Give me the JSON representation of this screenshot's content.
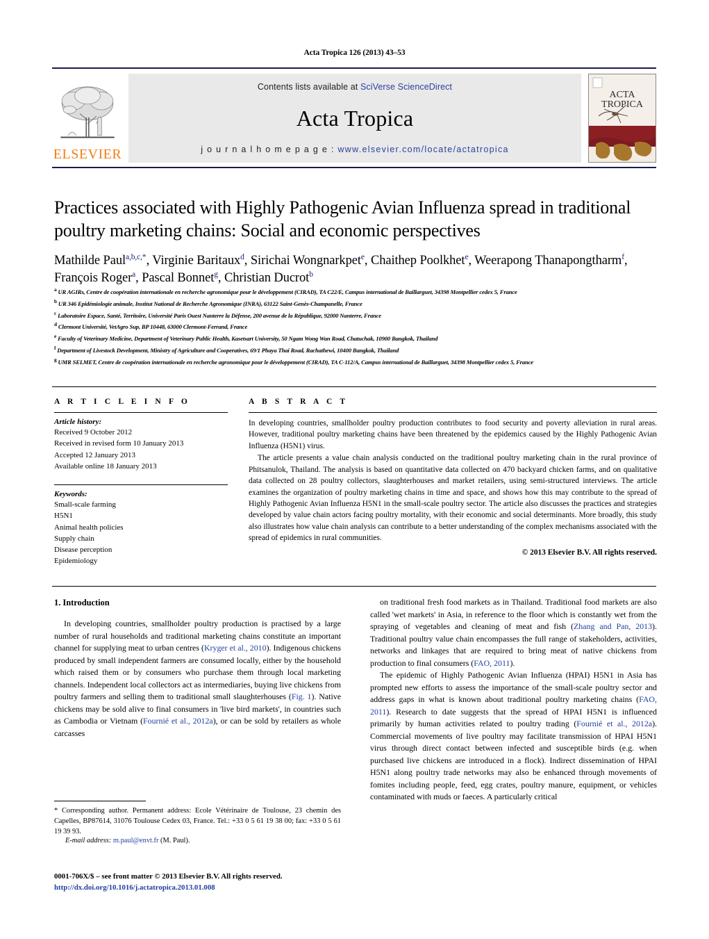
{
  "running_head": "Acta Tropica 126 (2013) 43–53",
  "masthead": {
    "contents_prefix": "Contents lists available at ",
    "contents_link": "SciVerse ScienceDirect",
    "journal_name": "Acta Tropica",
    "homepage_prefix": "j o u r n a l   h o m e p a g e :  ",
    "homepage_url": "www.elsevier.com/locate/actatropica",
    "publisher_wordmark": "ELSEVIER",
    "cover_line1": "ACTA",
    "cover_line2": "TROPICA",
    "accent_color": "#2b3f9e",
    "rule_color": "#1a1a4e",
    "elsevier_orange": "#f07e13"
  },
  "article": {
    "title": "Practices associated with Highly Pathogenic Avian Influenza spread in traditional poultry marketing chains: Social and economic perspectives",
    "authors_line_1": "Mathilde Paul",
    "authors": [
      {
        "name": "Mathilde Paul",
        "sup": "a,b,c,*"
      },
      {
        "name": "Virginie Baritaux",
        "sup": "d"
      },
      {
        "name": "Sirichai Wongnarkpet",
        "sup": "e"
      },
      {
        "name": "Chaithep Poolkhet",
        "sup": "e"
      },
      {
        "name": "Weerapong Thanapongtharm",
        "sup": "f"
      },
      {
        "name": "François Roger",
        "sup": "a"
      },
      {
        "name": "Pascal Bonnet",
        "sup": "g"
      },
      {
        "name": "Christian Ducrot",
        "sup": "b"
      }
    ],
    "affiliations": [
      {
        "mark": "a",
        "text": "UR AGIRs, Centre de coopération internationale en recherche agronomique pour le développement (CIRAD), TA C22/E, Campus international de Baillarguet, 34398 Montpellier cedex 5, France"
      },
      {
        "mark": "b",
        "text": "UR 346 Epidémiologie animale, Institut National de Recherche Agronomique (INRA), 63122 Saint-Genès-Champanelle, France"
      },
      {
        "mark": "c",
        "text": "Laboratoire Espace, Santé, Territoire, Université Paris Ouest Nanterre la Défense, 200 avenue de la République, 92000 Nanterre, France"
      },
      {
        "mark": "d",
        "text": "Clermont Université, VetAgro Sup, BP 10448, 63000 Clermont-Ferrand, France"
      },
      {
        "mark": "e",
        "text": "Faculty of Veterinary Medicine, Department of Veterinary Public Health, Kasetsart University, 50 Ngam Wong Wan Road, Chatuchak, 10900 Bangkok, Thailand"
      },
      {
        "mark": "f",
        "text": "Department of Livestock Development, Ministry of Agriculture and Cooperatives, 69/1 Phaya Thai Road, Rachathewi, 10400 Bangkok, Thailand"
      },
      {
        "mark": "g",
        "text": "UMR SELMET, Centre de coopération internationale en recherche agronomique pour le développement (CIRAD), TA C-112/A, Campus international de Baillarguet, 34398 Montpellier cedex 5, France"
      }
    ]
  },
  "article_info": {
    "heading": "A R T I C L E   I N F O",
    "history_label": "Article history:",
    "history": [
      "Received 9 October 2012",
      "Received in revised form 10 January 2013",
      "Accepted 12 January 2013",
      "Available online 18 January 2013"
    ],
    "keywords_label": "Keywords:",
    "keywords": [
      "Small-scale farming",
      "H5N1",
      "Animal health policies",
      "Supply chain",
      "Disease perception",
      "Epidemiology"
    ]
  },
  "abstract": {
    "heading": "A B S T R A C T",
    "paragraph_1": "In developing countries, smallholder poultry production contributes to food security and poverty alleviation in rural areas. However, traditional poultry marketing chains have been threatened by the epidemics caused by the Highly Pathogenic Avian Influenza (H5N1) virus.",
    "paragraph_2": "The article presents a value chain analysis conducted on the traditional poultry marketing chain in the rural province of Phitsanulok, Thailand. The analysis is based on quantitative data collected on 470 backyard chicken farms, and on qualitative data collected on 28 poultry collectors, slaughterhouses and market retailers, using semi-structured interviews. The article examines the organization of poultry marketing chains in time and space, and shows how this may contribute to the spread of Highly Pathogenic Avian Influenza H5N1 in the small-scale poultry sector. The article also discusses the practices and strategies developed by value chain actors facing poultry mortality, with their economic and social determinants. More broadly, this study also illustrates how value chain analysis can contribute to a better understanding of the complex mechanisms associated with the spread of epidemics in rural communities.",
    "copyright": "© 2013 Elsevier B.V. All rights reserved."
  },
  "body": {
    "section_heading": "1.  Introduction",
    "left_column_html": "In developing countries, smallholder poultry production is practised by a large number of rural households and traditional marketing chains constitute an important channel for supplying meat to urban centres (<span class=\"cite\">Kryger et al., 2010</span>). Indigenous chickens produced by small independent farmers are consumed locally, either by the household which raised them or by consumers who purchase them through local marketing channels. Independent local collectors act as intermediaries, buying live chickens from poultry farmers and selling them to traditional small slaughterhouses (<span class=\"cite\">Fig. 1</span>). Native chickens may be sold alive to final consumers in 'live bird markets', in countries such as Cambodia or Vietnam (<span class=\"cite\">Fournié et al., 2012a</span>), or can be sold by retailers as whole carcasses",
    "right_column_html": "on traditional fresh food markets as in Thailand. Traditional food markets are also called 'wet markets' in Asia, in reference to the floor which is constantly wet from the spraying of vegetables and cleaning of meat and fish (<span class=\"cite\">Zhang and Pan, 2013</span>). Traditional poultry value chain encompasses the full range of stakeholders, activities, networks and linkages that are required to bring meat of native chickens from production to final consumers (<span class=\"cite\">FAO, 2011</span>).<br><span style=\"display:inline-block;width:14px\"></span>The epidemic of Highly Pathogenic Avian Influenza (HPAI) H5N1 in Asia has prompted new efforts to assess the importance of the small-scale poultry sector and address gaps in what is known about traditional poultry marketing chains (<span class=\"cite\">FAO, 2011</span>). Research to date suggests that the spread of HPAI H5N1 is influenced primarily by human activities related to poultry trading (<span class=\"cite\">Fournié et al., 2012a</span>). Commercial movements of live poultry may facilitate transmission of HPAI H5N1 virus through direct contact between infected and susceptible birds (e.g. when purchased live chickens are introduced in a flock). Indirect dissemination of HPAI H5N1 along poultry trade networks may also be enhanced through movements of fomites including people, feed, egg crates, poultry manure, equipment, or vehicles contaminated with muds or faeces. A particularly critical"
  },
  "footnotes": {
    "corresponding_html": "* Corresponding author. Permanent address: Ecole Vétérinaire de Toulouse, 23 chemin des Capelles, BP87614, 31076 Toulouse Cedex 03, France. Tel.: +33 0 5 61 19 38 00; fax: +33 0 5 61 19 39 93.",
    "email_label": "E-mail address:",
    "email_address": "m.paul@envt.fr",
    "email_owner": "(M. Paul).",
    "issn_line": "0001-706X/$ – see front matter © 2013 Elsevier B.V. All rights reserved.",
    "doi": "http://dx.doi.org/10.1016/j.actatropica.2013.01.008"
  }
}
